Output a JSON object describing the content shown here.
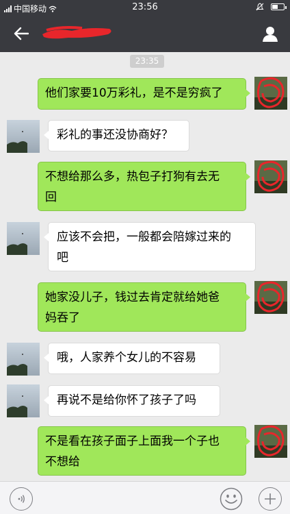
{
  "status_bar": {
    "carrier": "中国移动",
    "time": "23:56"
  },
  "nav": {
    "title_redacted": true
  },
  "timestamp": "23:35",
  "messages": [
    {
      "side": "sent",
      "text": "他们家要10万彩礼，是不是穷疯了"
    },
    {
      "side": "received",
      "text": "彩礼的事还没协商好？"
    },
    {
      "side": "sent",
      "text_line1": "不想给那么多，热包子打狗有去无",
      "text_line2": "回"
    },
    {
      "side": "received",
      "text_line1": "应该不会把，一般都会陪嫁过来的",
      "text_line2": "吧"
    },
    {
      "side": "sent",
      "text_line1": "她家没儿子，钱过去肯定就给她爸",
      "text_line2": "妈吞了"
    },
    {
      "side": "received",
      "text": "哦，人家养个女儿的不容易"
    },
    {
      "side": "received",
      "text": "再说不是给你怀了孩子了吗"
    },
    {
      "side": "sent",
      "text_line1": "不是看在孩子面子上面我一个子也",
      "text_line2": "不想给"
    }
  ],
  "colors": {
    "bar": "#393a3f",
    "chat_bg": "#ebebeb",
    "sent_bubble": "#a0e75a",
    "received_bubble": "#ffffff",
    "redaction": "#e8262b"
  },
  "icons": {
    "back": "arrow-left-icon",
    "contact": "person-icon",
    "voice": "voice-icon",
    "emoji": "smiley-icon",
    "plus": "plus-icon"
  }
}
